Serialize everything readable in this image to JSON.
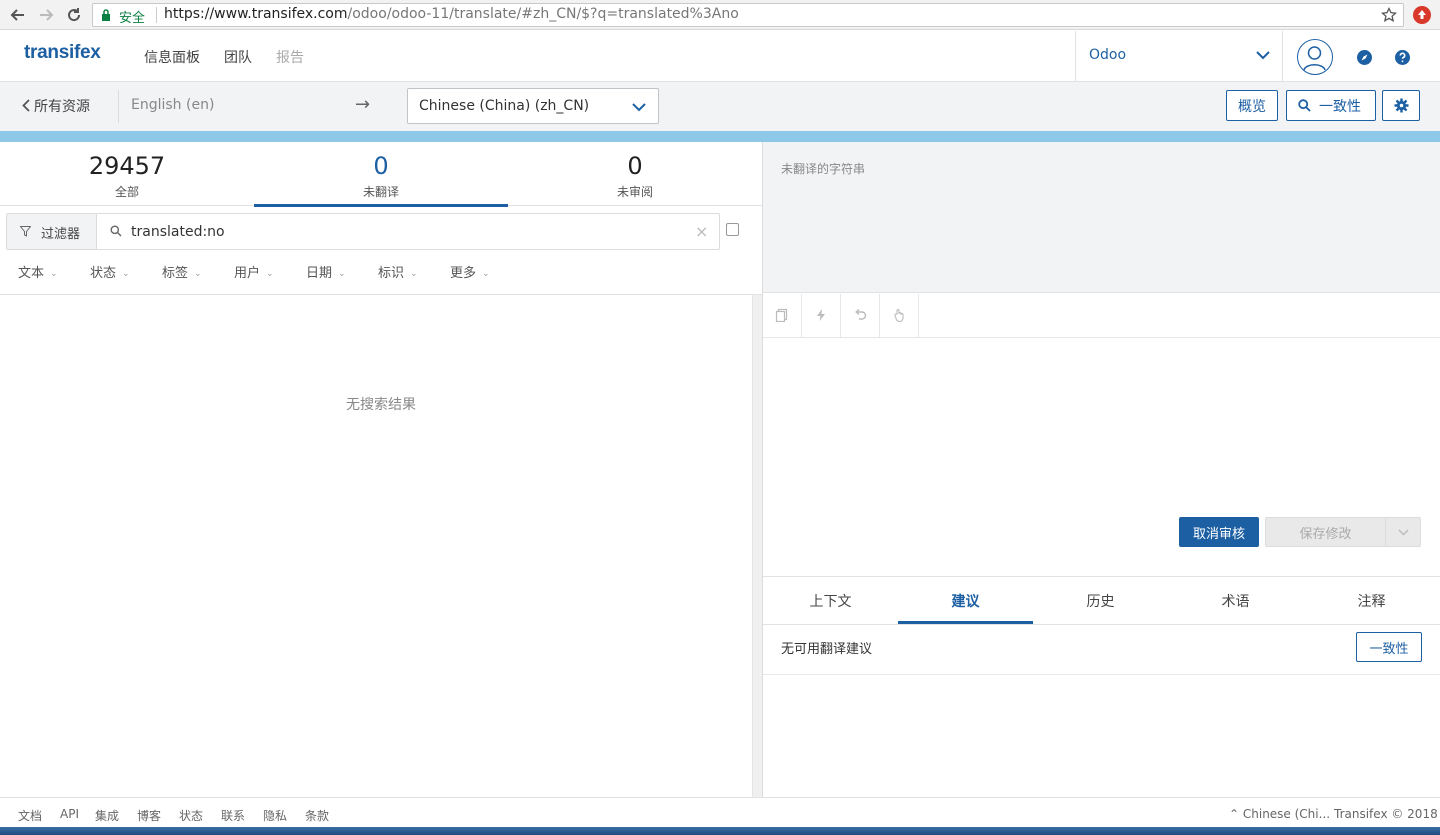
{
  "browser": {
    "secure_label": "安全",
    "url_host": "https://www.transifex.com",
    "url_path": "/odoo/odoo-11/translate/#zh_CN/$?q=translated%3Ano"
  },
  "nav": {
    "logo": "transifex",
    "links": [
      "信息面板",
      "团队",
      "报告"
    ],
    "project": "Odoo"
  },
  "toolbar": {
    "back_label": "所有资源",
    "source_lang": "English (en)",
    "arrow": "→",
    "target_lang": "Chinese (China) (zh_CN)",
    "overview_label": "概览",
    "consistency_label": "一致性"
  },
  "stats": [
    {
      "value": "29457",
      "label": "全部"
    },
    {
      "value": "0",
      "label": "未翻译"
    },
    {
      "value": "0",
      "label": "未审阅"
    }
  ],
  "filter": {
    "button_label": "过滤器",
    "query": "translated:no",
    "clear": "×",
    "facets": [
      "文本",
      "状态",
      "标签",
      "用户",
      "日期",
      "标识",
      "更多"
    ]
  },
  "list": {
    "empty_message": "无搜索结果"
  },
  "source": {
    "message": "未翻译的字符串"
  },
  "editor": {
    "unreview_label": "取消审核",
    "save_label": "保存修改"
  },
  "tabs": [
    "上下文",
    "建议",
    "历史",
    "术语",
    "注释"
  ],
  "suggestions": {
    "empty_message": "无可用翻译建议",
    "tm_button": "一致性"
  },
  "footer": {
    "links": [
      "文档",
      "API",
      "集成",
      "博客",
      "状态",
      "联系",
      "隐私",
      "条款"
    ],
    "language": "⌃ Chinese (Chi...",
    "copyright": "Transifex © 2018"
  },
  "colors": {
    "brand": "#1d5fa3",
    "band": "#8ec8e8"
  }
}
